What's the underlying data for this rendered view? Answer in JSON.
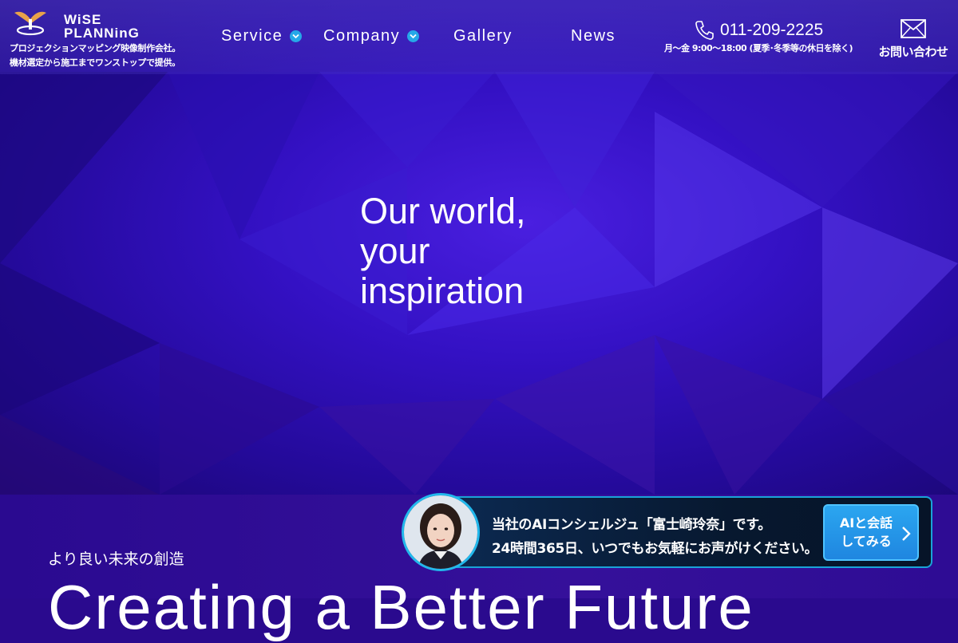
{
  "brand": {
    "logo_line1": "WiSE",
    "logo_line2": "PLANNinG",
    "tagline_line1": "プロジェクションマッピング映像制作会社。",
    "tagline_line2": "機材選定から施工までワンストップで提供。"
  },
  "nav": {
    "items": [
      {
        "label": "Service",
        "dropdown": true
      },
      {
        "label": "Company",
        "dropdown": true
      },
      {
        "label": "Gallery",
        "dropdown": false
      },
      {
        "label": "News",
        "dropdown": false
      }
    ]
  },
  "contact": {
    "phone": "011-209-2225",
    "hours": "月〜金 9:00〜18:00 (夏季･冬季等の休日を除く)",
    "inquiry_label": "お問い合わせ"
  },
  "hero": {
    "line1": "Our world,",
    "line2": "your",
    "line3": "inspiration"
  },
  "section": {
    "subtitle": "より良い未来の創造",
    "title": "Creating a Better Future"
  },
  "ai_concierge": {
    "line1": "当社のAIコンシェルジュ「富士崎玲奈」です。",
    "line2": "24時間365日、いつでもお気軽にお声がけください。",
    "button_line1": "AIと会話",
    "button_line2": "してみる"
  },
  "colors": {
    "accent_blue": "#26a8e8",
    "hero_purple": "#3411c4",
    "banner_dark": "#07182f"
  },
  "icons": [
    "logo-emblem",
    "chevron-down-icon",
    "phone-icon",
    "mail-icon",
    "chevron-right-icon"
  ]
}
